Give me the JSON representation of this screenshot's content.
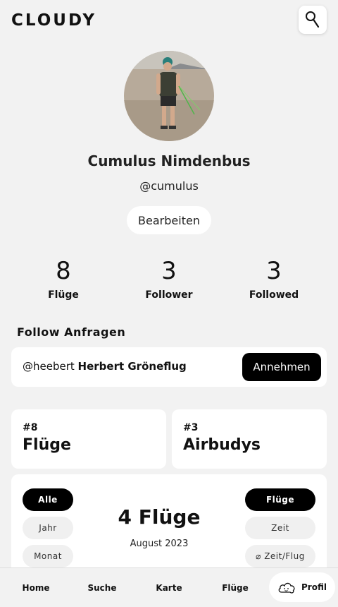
{
  "app": {
    "logo": "CLOUDY"
  },
  "header": {
    "search_icon": "search-icon"
  },
  "profile": {
    "name": "Cumulus Nimdenbus",
    "handle": "@cumulus",
    "edit_label": "Bearbeiten"
  },
  "stats": [
    {
      "value": "8",
      "label": "Flüge"
    },
    {
      "value": "3",
      "label": "Follower"
    },
    {
      "value": "3",
      "label": "Followed"
    }
  ],
  "requests": {
    "title": "Follow Anfragen",
    "items": [
      {
        "handle": "@heebert",
        "name": "Herbert Gröneflug",
        "action": "Annehmen"
      }
    ]
  },
  "summary_cards": [
    {
      "rank": "#8",
      "title": "Flüge"
    },
    {
      "rank": "#3",
      "title": "Airbudys"
    }
  ],
  "flight_stats": {
    "period_filters": [
      "Alle",
      "Jahr",
      "Monat"
    ],
    "active_period": "Alle",
    "metric_filters": [
      "Flüge",
      "Zeit",
      "⌀ Zeit/Flug"
    ],
    "active_metric": "Flüge",
    "headline": "4 Flüge",
    "subline": "August 2023"
  },
  "nav": {
    "items": [
      "Home",
      "Suche",
      "Karte",
      "Flüge",
      "Profil"
    ],
    "active": "Profil",
    "profile_icon": "cloud-icon"
  },
  "colors": {
    "background": "#f2f2f2",
    "card": "#ffffff",
    "accent": "#000000"
  }
}
